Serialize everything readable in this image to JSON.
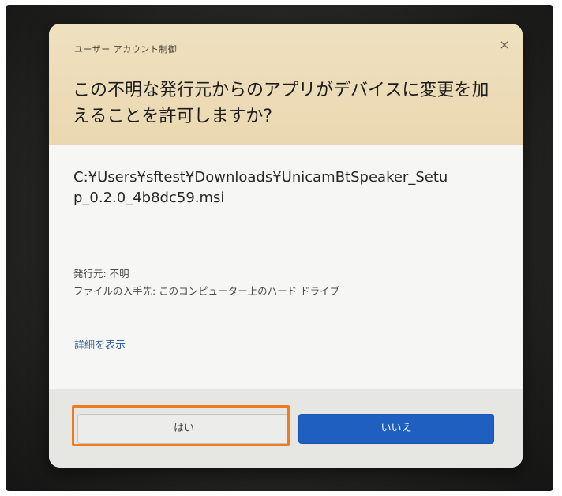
{
  "dialog": {
    "header_title": "ユーザー アカウント制御",
    "close_label": "×",
    "question": "この不明な発行元からのアプリがデバイスに変更を加えることを許可しますか?",
    "file_path": "C:¥Users¥sftest¥Downloads¥UnicamBtSpeaker_Setup_0.2.0_4b8dc59.msi",
    "publisher": "発行元: 不明",
    "origin": "ファイルの入手先: このコンピューター上のハード ドライブ",
    "details_link": "詳細を表示",
    "yes_label": "はい",
    "no_label": "いいえ"
  },
  "colors": {
    "header_bg": "#ead8b0",
    "primary_button": "#1f5fbf",
    "highlight_box": "#ee7a22",
    "link": "#2f5fa8"
  },
  "icons": {
    "close": "close-icon"
  }
}
